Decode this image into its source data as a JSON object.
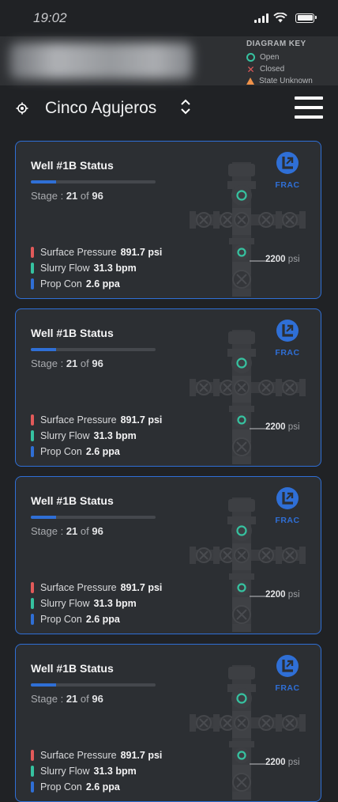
{
  "status": {
    "time": "19:02"
  },
  "legend": {
    "title": "DIAGRAM KEY",
    "items": [
      {
        "label": "Open",
        "icon": "open-circle-icon",
        "color": "#36c2a0"
      },
      {
        "label": "Closed",
        "icon": "closed-x-icon",
        "color": "#e25a5a"
      },
      {
        "label": "State Unknown",
        "icon": "unknown-triangle-icon",
        "color": "#f0924a"
      }
    ]
  },
  "site": {
    "name": "Cinco Agujeros"
  },
  "colors": {
    "accent": "#2f6fd6",
    "pressure": "#e25a5a",
    "slurry": "#36c2a0",
    "prop": "#2f6fd6",
    "card_bg": "#2c2f33"
  },
  "cards": [
    {
      "title": "Well #1B Status",
      "stage_label": "Stage :",
      "stage_current": "21",
      "stage_of": "of",
      "stage_total": "96",
      "progress": 0.2,
      "metrics": [
        {
          "label": "Surface Pressure",
          "value": "891.7 psi"
        },
        {
          "label": "Slurry Flow",
          "value": "31.3 bpm"
        },
        {
          "label": "Prop Con",
          "value": "2.6 ppa"
        }
      ],
      "badge": "FRAC",
      "pressure_value": "2200",
      "pressure_unit": "psi"
    },
    {
      "title": "Well #1B Status",
      "stage_label": "Stage :",
      "stage_current": "21",
      "stage_of": "of",
      "stage_total": "96",
      "progress": 0.2,
      "metrics": [
        {
          "label": "Surface Pressure",
          "value": "891.7 psi"
        },
        {
          "label": "Slurry Flow",
          "value": "31.3 bpm"
        },
        {
          "label": "Prop Con",
          "value": "2.6 ppa"
        }
      ],
      "badge": "FRAC",
      "pressure_value": "2200",
      "pressure_unit": "psi"
    },
    {
      "title": "Well #1B Status",
      "stage_label": "Stage :",
      "stage_current": "21",
      "stage_of": "of",
      "stage_total": "96",
      "progress": 0.2,
      "metrics": [
        {
          "label": "Surface Pressure",
          "value": "891.7 psi"
        },
        {
          "label": "Slurry Flow",
          "value": "31.3 bpm"
        },
        {
          "label": "Prop Con",
          "value": "2.6 ppa"
        }
      ],
      "badge": "FRAC",
      "pressure_value": "2200",
      "pressure_unit": "psi"
    },
    {
      "title": "Well #1B Status",
      "stage_label": "Stage :",
      "stage_current": "21",
      "stage_of": "of",
      "stage_total": "96",
      "progress": 0.2,
      "metrics": [
        {
          "label": "Surface Pressure",
          "value": "891.7 psi"
        },
        {
          "label": "Slurry Flow",
          "value": "31.3 bpm"
        },
        {
          "label": "Prop Con",
          "value": "2.6 ppa"
        }
      ],
      "badge": "FRAC",
      "pressure_value": "2200",
      "pressure_unit": "psi"
    }
  ]
}
